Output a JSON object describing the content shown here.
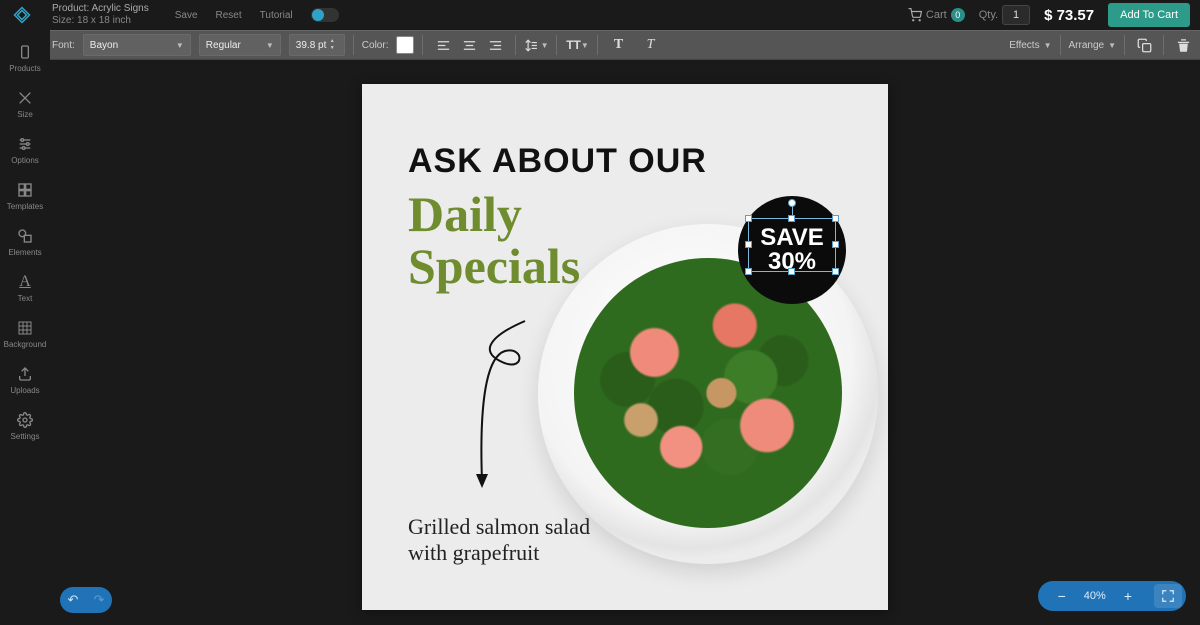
{
  "header": {
    "product_label": "Product: Acrylic Signs",
    "size_label": "Size: 18 x 18 inch",
    "save": "Save",
    "reset": "Reset",
    "tutorial": "Tutorial",
    "cart_label": "Cart",
    "cart_count": "0",
    "qty_label": "Qty.",
    "qty_value": "1",
    "price": "$ 73.57",
    "add_to_cart": "Add To Cart"
  },
  "toolbar": {
    "font_label": "Font:",
    "font_value": "Bayon",
    "weight_value": "Regular",
    "size_value": "39.8 pt",
    "color_label": "Color:",
    "effects": "Effects",
    "arrange": "Arrange"
  },
  "sidebar": {
    "items": [
      {
        "label": "Products"
      },
      {
        "label": "Size"
      },
      {
        "label": "Options"
      },
      {
        "label": "Templates"
      },
      {
        "label": "Elements"
      },
      {
        "label": "Text"
      },
      {
        "label": "Background"
      },
      {
        "label": "Uploads"
      },
      {
        "label": "Settings"
      }
    ]
  },
  "canvas": {
    "headline": "ASK ABOUT OUR",
    "specials_l1": "Daily",
    "specials_l2": "Specials",
    "badge_l1": "SAVE",
    "badge_l2": "30%",
    "desc_l1": "Grilled salmon salad",
    "desc_l2": "with grapefruit"
  },
  "footer": {
    "zoom": "40%"
  }
}
